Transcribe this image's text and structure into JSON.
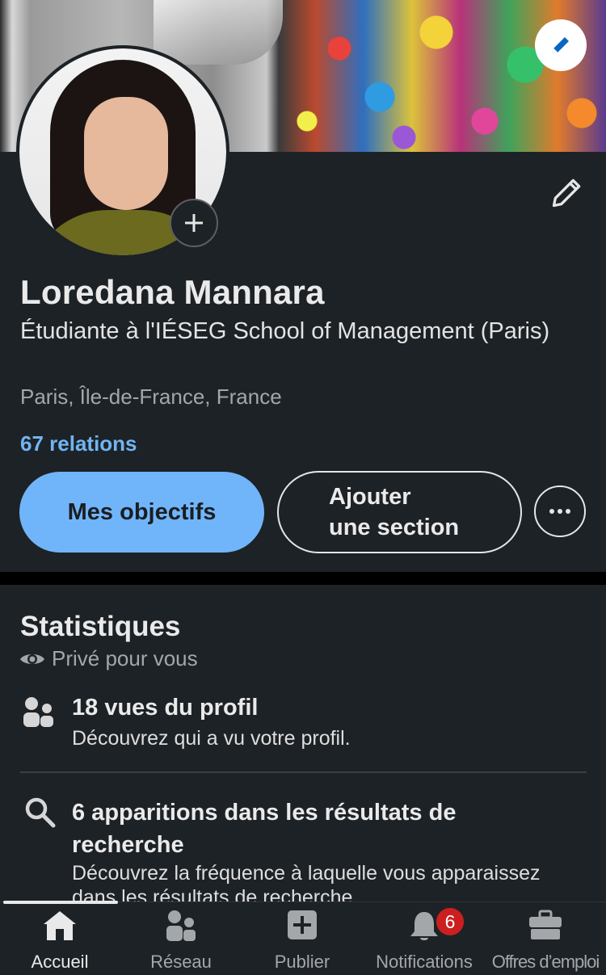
{
  "profile": {
    "name": "Loredana Mannara",
    "headline": "Étudiante à l'IÉSEG School of Management (Paris)",
    "location": "Paris, Île-de-France, France",
    "connections": "67 relations"
  },
  "actions": {
    "primary_label": "Mes objectifs",
    "secondary_label": "Ajouter\nune section"
  },
  "stats": {
    "title": "Statistiques",
    "privacy": "Privé pour vous",
    "items": [
      {
        "title": "18 vues du profil",
        "desc": "Découvrez qui a vu votre profil.",
        "icon": "people-icon"
      },
      {
        "title": "6 apparitions dans les résultats de recherche",
        "desc": "Découvrez la fréquence à laquelle vous apparaissez dans les résultats de recherche",
        "icon": "search-icon"
      }
    ]
  },
  "tabbar": {
    "items": [
      {
        "label": "Accueil",
        "icon": "home-icon",
        "active": true
      },
      {
        "label": "Réseau",
        "icon": "network-icon",
        "active": false
      },
      {
        "label": "Publier",
        "icon": "post-icon",
        "active": false
      },
      {
        "label": "Notifications",
        "icon": "bell-icon",
        "active": false
      },
      {
        "label": "Offres d’emploi",
        "icon": "briefcase-icon",
        "active": false
      }
    ],
    "notification_count": "6"
  },
  "colors": {
    "background": "#1d2226",
    "accent": "#70b5f9",
    "link": "#72b4f3",
    "badge": "#cc1f1f"
  }
}
